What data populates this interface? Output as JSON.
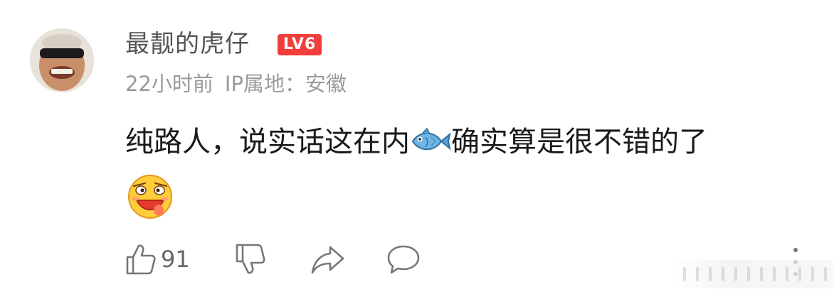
{
  "comment": {
    "username": "最靓的虎仔",
    "level": "LV6",
    "time": "22小时前",
    "ip_location": "IP属地：安徽",
    "text_before_emoji": "纯路人，说实话这在内",
    "text_after_emoji": "确实算是很不错的了",
    "inline_emoji": "fish-emoji",
    "sticker": "drooling-face-sticker",
    "like_count": "91"
  },
  "actions": {
    "like_icon": "thumbs-up-icon",
    "dislike_icon": "thumbs-down-icon",
    "share_icon": "share-icon",
    "reply_icon": "comment-bubble-icon",
    "more_icon": "more-vertical-icon"
  },
  "colors": {
    "level_badge": "#f23d3d",
    "username": "#555555",
    "meta": "#9a9a9a",
    "content": "#1a1a1a",
    "icon": "#777777"
  }
}
